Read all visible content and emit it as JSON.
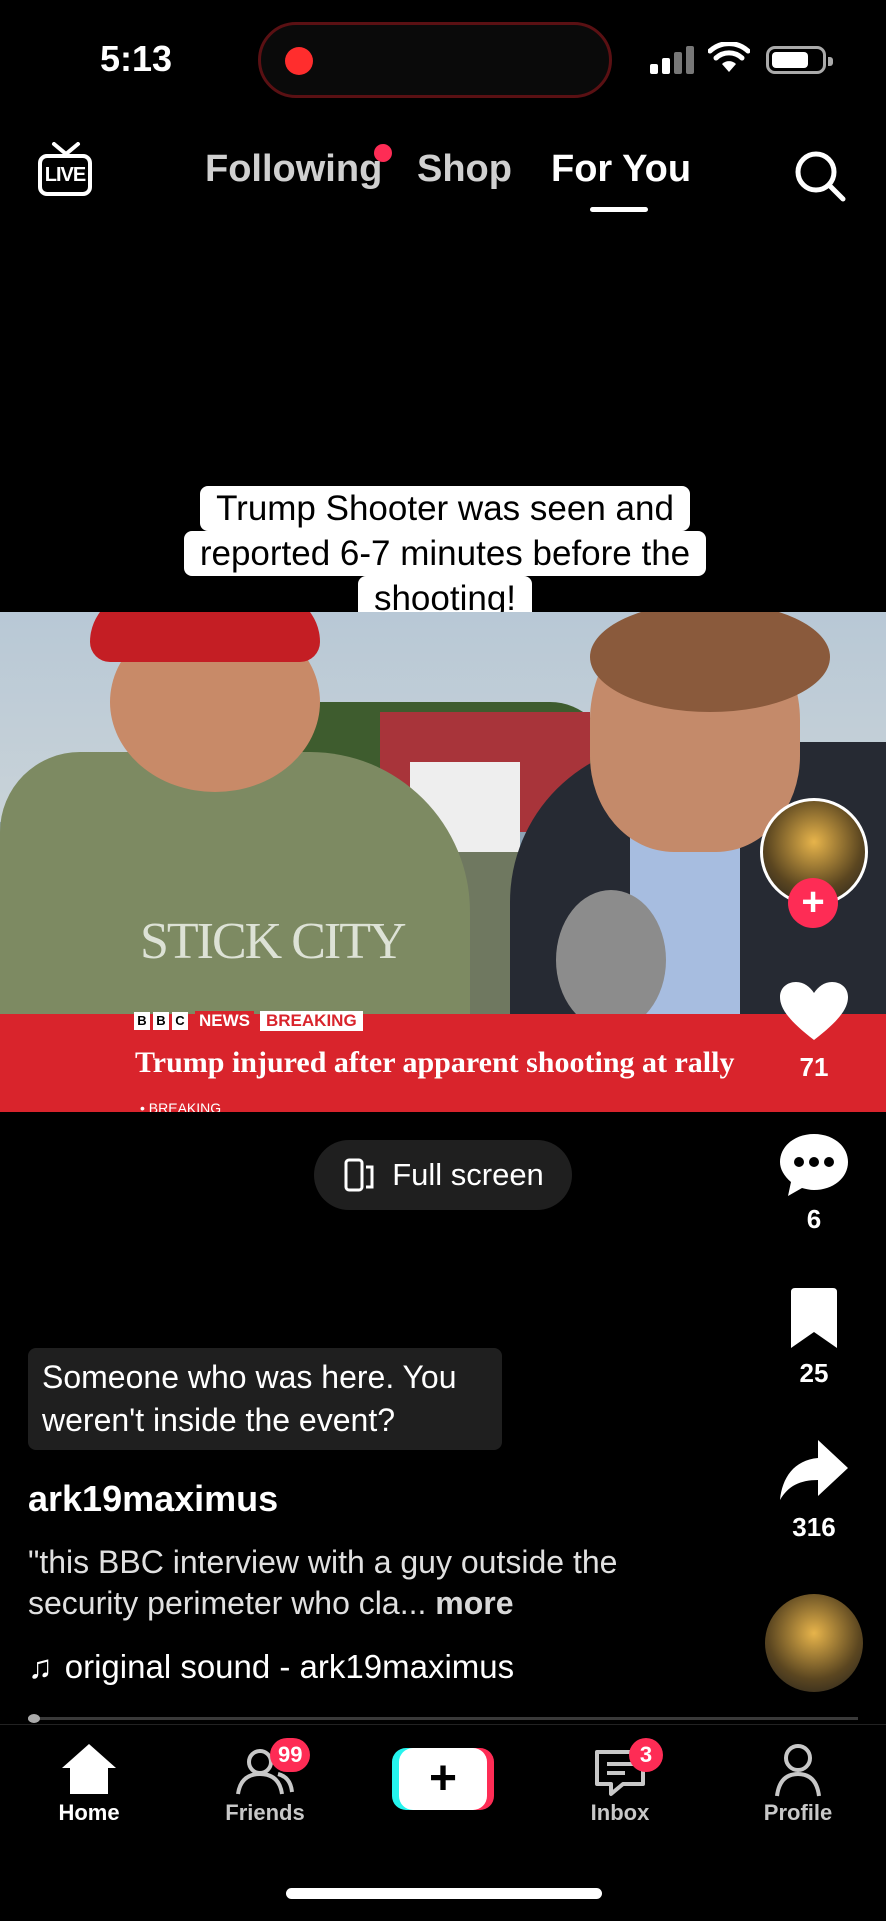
{
  "status_bar": {
    "time": "5:13"
  },
  "top_nav": {
    "live_label": "LIVE",
    "tabs": [
      {
        "label": "Following",
        "has_dot": true
      },
      {
        "label": "Shop"
      },
      {
        "label": "For You",
        "active": true
      }
    ]
  },
  "video": {
    "caption": "Trump Shooter was seen and reported 6-7 minutes before the shooting!",
    "shirt_text": "STICK CITY",
    "news_banner": {
      "bbc_letters": [
        "B",
        "B",
        "C"
      ],
      "network": "NEWS",
      "tag": "BREAKING",
      "headline": "Trump injured after apparent shooting at rally",
      "ticker": "• BREAKING"
    },
    "fullscreen_label": "Full screen"
  },
  "actions": {
    "likes": "71",
    "comments": "6",
    "saves": "25",
    "shares": "316"
  },
  "post": {
    "reply_comment": "Someone who was here. You weren't inside the event?",
    "username": "ark19maximus",
    "description": "\"this BBC interview with a guy outside the security perimeter who cla...",
    "more_label": "more",
    "sound": "original sound - ark19maximus"
  },
  "bottom_nav": {
    "home": "Home",
    "friends": "Friends",
    "friends_badge": "99",
    "inbox": "Inbox",
    "inbox_badge": "3",
    "profile": "Profile"
  },
  "colors": {
    "accent": "#fe2c55",
    "cyan": "#25f4ee",
    "bbc_red": "#d9242c"
  }
}
